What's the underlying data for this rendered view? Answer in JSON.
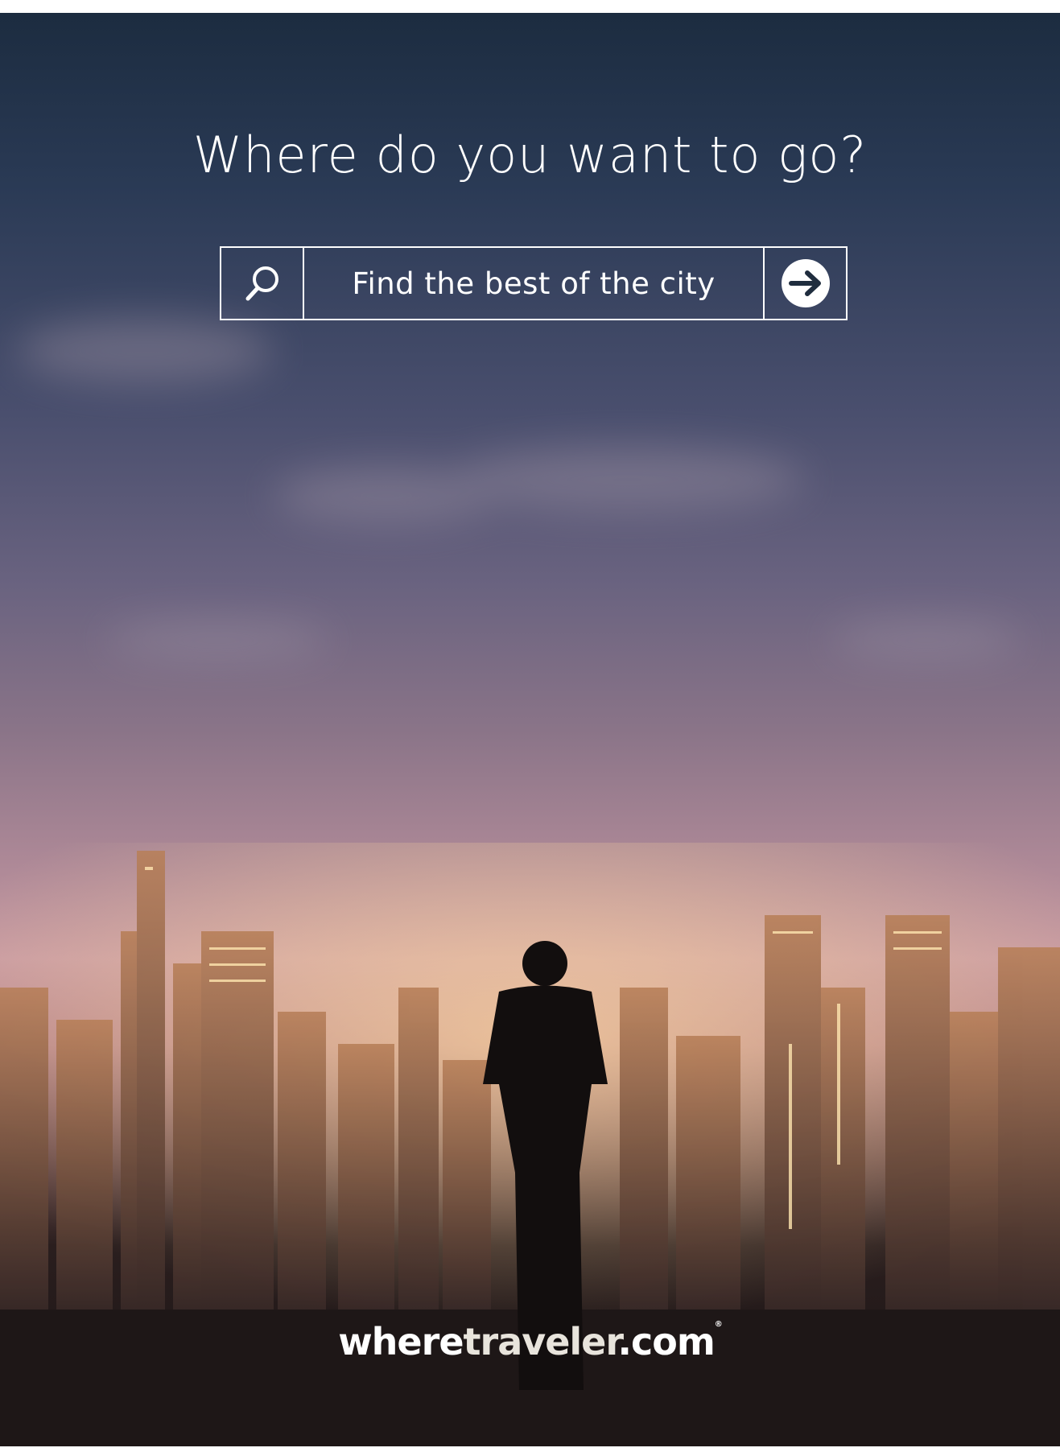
{
  "headline": "Where do you want to go?",
  "search": {
    "placeholder": "Find the best of the city",
    "search_icon": "search-icon",
    "go_icon": "arrow-right-circle-icon"
  },
  "logo": {
    "part1": "where",
    "part2": "traveler",
    "part3": ".com",
    "mark": "®"
  },
  "colors": {
    "text": "#ffffff",
    "sky_top": "#1c2c40",
    "sky_glow": "#c89aa2"
  }
}
